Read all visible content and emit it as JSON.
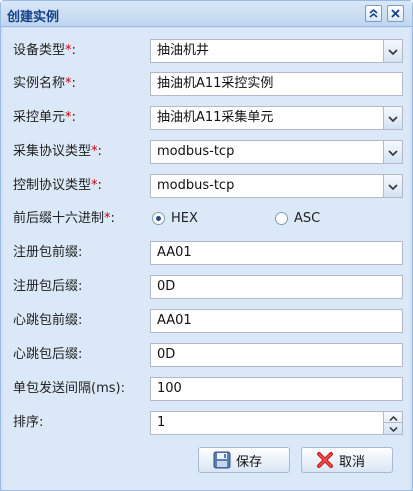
{
  "window": {
    "title": "创建实例",
    "tools": [
      "collapse-icon",
      "close-icon"
    ]
  },
  "form": {
    "device_type": {
      "label": "设备类型",
      "value": "抽油机井"
    },
    "instance_name": {
      "label": "实例名称",
      "value": "抽油机A11采控实例"
    },
    "control_unit": {
      "label": "采控单元",
      "value": "抽油机A11采集单元"
    },
    "acq_protocol": {
      "label": "采集协议类型",
      "value": "modbus-tcp"
    },
    "ctrl_protocol": {
      "label": "控制协议类型",
      "value": "modbus-tcp"
    },
    "hex_prefix": {
      "label": "前后缀十六进制",
      "options": [
        "HEX",
        "ASC"
      ],
      "selected": "HEX"
    },
    "reg_prefix": {
      "label": "注册包前缀:",
      "value": "AA01"
    },
    "reg_suffix": {
      "label": "注册包后缀:",
      "value": "0D"
    },
    "hb_prefix": {
      "label": "心跳包前缀:",
      "value": "AA01"
    },
    "hb_suffix": {
      "label": "心跳包后缀:",
      "value": "0D"
    },
    "send_interval": {
      "label": "单包发送间隔(ms):",
      "value": "100"
    },
    "sort": {
      "label": "排序:",
      "value": "1"
    },
    "required_mark": "*",
    "colon": ":"
  },
  "buttons": {
    "save": "保存",
    "cancel": "取消"
  },
  "colors": {
    "header_text": "#15428b",
    "required": "#d10000",
    "panel_bg": "#dbe8f7"
  }
}
